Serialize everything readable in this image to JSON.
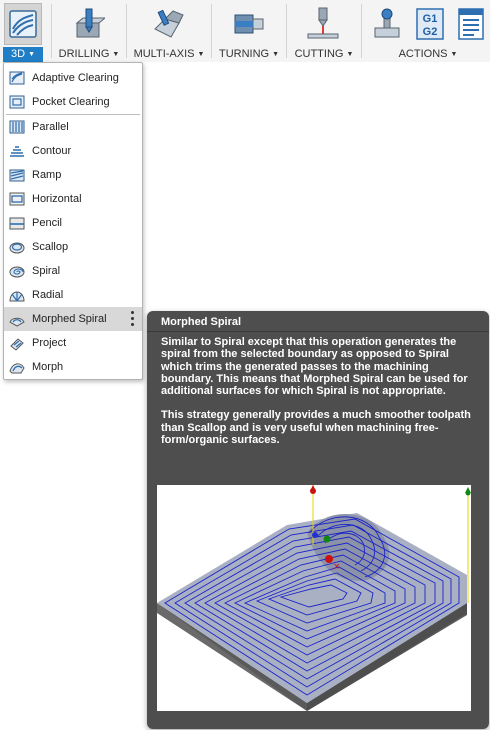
{
  "toolbar": {
    "groups": [
      {
        "label": "3D",
        "icon": "3d-milling-icon"
      },
      {
        "label": "DRILLING",
        "icon": "drill-icon"
      },
      {
        "label": "MULTI-AXIS",
        "icon": "multi-axis-icon"
      },
      {
        "label": "TURNING",
        "icon": "turning-icon"
      },
      {
        "label": "CUTTING",
        "icon": "cutting-icon"
      },
      {
        "label": "ACTIONS",
        "icon": "actions-icon"
      }
    ],
    "actions_icons": {
      "simulate": "simulate-icon",
      "post_code": "G1\nG2",
      "setup_sheet": "setup-sheet-icon"
    },
    "active_color": "#1f7ec6"
  },
  "menu": {
    "items": [
      {
        "label": "Adaptive Clearing",
        "icon": "adaptive-clearing-icon"
      },
      {
        "label": "Pocket Clearing",
        "icon": "pocket-clearing-icon"
      },
      {
        "label": "Parallel",
        "icon": "parallel-icon"
      },
      {
        "label": "Contour",
        "icon": "contour-icon"
      },
      {
        "label": "Ramp",
        "icon": "ramp-icon"
      },
      {
        "label": "Horizontal",
        "icon": "horizontal-icon"
      },
      {
        "label": "Pencil",
        "icon": "pencil-icon"
      },
      {
        "label": "Scallop",
        "icon": "scallop-icon"
      },
      {
        "label": "Spiral",
        "icon": "spiral-icon"
      },
      {
        "label": "Radial",
        "icon": "radial-icon"
      },
      {
        "label": "Morphed Spiral",
        "icon": "morphed-spiral-icon",
        "selected": true
      },
      {
        "label": "Project",
        "icon": "project-icon"
      },
      {
        "label": "Morph",
        "icon": "morph-icon"
      }
    ]
  },
  "tooltip": {
    "title": "Morphed Spiral",
    "paragraph1": "Similar to Spiral except that this operation generates the spiral from the selected boundary as opposed to Spiral which trims the generated passes to the machining boundary. This means that Morphed Spiral can be used for additional surfaces for which Spiral is not appropriate.",
    "paragraph2": "This strategy generally provides a much smoother toolpath than Scallop and is very useful when machining free-form/organic surfaces.",
    "image": "morphed-spiral-toolpath-preview"
  }
}
